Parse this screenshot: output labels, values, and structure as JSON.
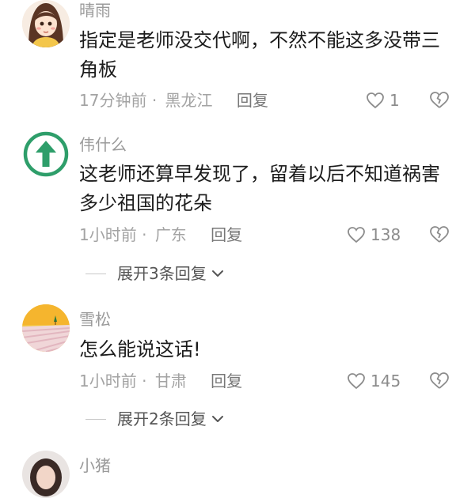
{
  "comments": [
    {
      "username": "晴雨",
      "text": "指定是老师没交代啊，不然不能这多没带三角板",
      "time": "17分钟前",
      "location": "黑龙江",
      "reply_label": "回复",
      "likes": "1",
      "avatar_icon": "cartoon-girl-avatar"
    },
    {
      "username": "伟什么",
      "text": "这老师还算早发现了，留着以后不知道祸害多少祖国的花朵",
      "time": "1小时前",
      "location": "广东",
      "reply_label": "回复",
      "likes": "138",
      "expand_label": "展开3条回复",
      "avatar_icon": "green-up-arrow-avatar"
    },
    {
      "username": "雪松",
      "text": "怎么能说这话!",
      "time": "1小时前",
      "location": "甘肃",
      "reply_label": "回复",
      "likes": "145",
      "expand_label": "展开2条回复",
      "avatar_icon": "sunset-landscape-avatar"
    },
    {
      "username": "小猪",
      "avatar_icon": "girl-photo-avatar"
    }
  ],
  "separator": "·",
  "colors": {
    "arrow_green": "#2e9e6a",
    "meta_gray": "#a3a3a3",
    "text_dark": "#1c1c1c"
  }
}
